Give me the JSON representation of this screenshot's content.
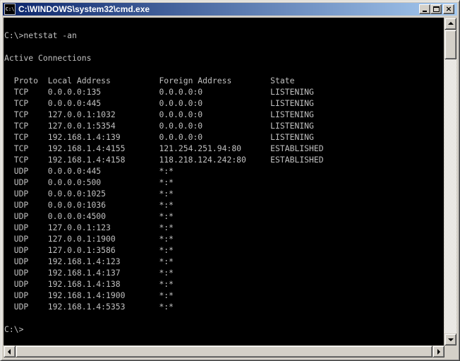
{
  "window": {
    "title": "C:\\WINDOWS\\system32\\cmd.exe",
    "icon_label": "C:\\"
  },
  "titlebar_buttons": {
    "minimize": "minimize-icon",
    "maximize": "maximize-icon",
    "close": "close-icon",
    "close_glyph": "×"
  },
  "console": {
    "lines": [
      "C:\\>netstat -an",
      "",
      "Active Connections",
      "",
      "  Proto  Local Address          Foreign Address        State",
      "  TCP    0.0.0.0:135            0.0.0.0:0              LISTENING",
      "  TCP    0.0.0.0:445            0.0.0.0:0              LISTENING",
      "  TCP    127.0.0.1:1032         0.0.0.0:0              LISTENING",
      "  TCP    127.0.0.1:5354         0.0.0.0:0              LISTENING",
      "  TCP    192.168.1.4:139        0.0.0.0:0              LISTENING",
      "  TCP    192.168.1.4:4155       121.254.251.94:80      ESTABLISHED",
      "  TCP    192.168.1.4:4158       118.218.124.242:80     ESTABLISHED",
      "  UDP    0.0.0.0:445            *:*",
      "  UDP    0.0.0.0:500            *:*",
      "  UDP    0.0.0.0:1025           *:*",
      "  UDP    0.0.0.0:1036           *:*",
      "  UDP    0.0.0.0:4500           *:*",
      "  UDP    127.0.0.1:123          *:*",
      "  UDP    127.0.0.1:1900         *:*",
      "  UDP    127.0.0.1:3586         *:*",
      "  UDP    192.168.1.4:123        *:*",
      "  UDP    192.168.1.4:137        *:*",
      "  UDP    192.168.1.4:138        *:*",
      "  UDP    192.168.1.4:1900       *:*",
      "  UDP    192.168.1.4:5353       *:*",
      "",
      "C:\\>"
    ]
  },
  "scrollbars": {
    "up": "scroll-up-arrow-icon",
    "down": "scroll-down-arrow-icon",
    "left": "scroll-left-arrow-icon",
    "right": "scroll-right-arrow-icon"
  },
  "colors": {
    "console_bg": "#000000",
    "console_fg": "#c0c0c0",
    "titlebar_start": "#0a246a",
    "titlebar_end": "#a6caf0"
  }
}
